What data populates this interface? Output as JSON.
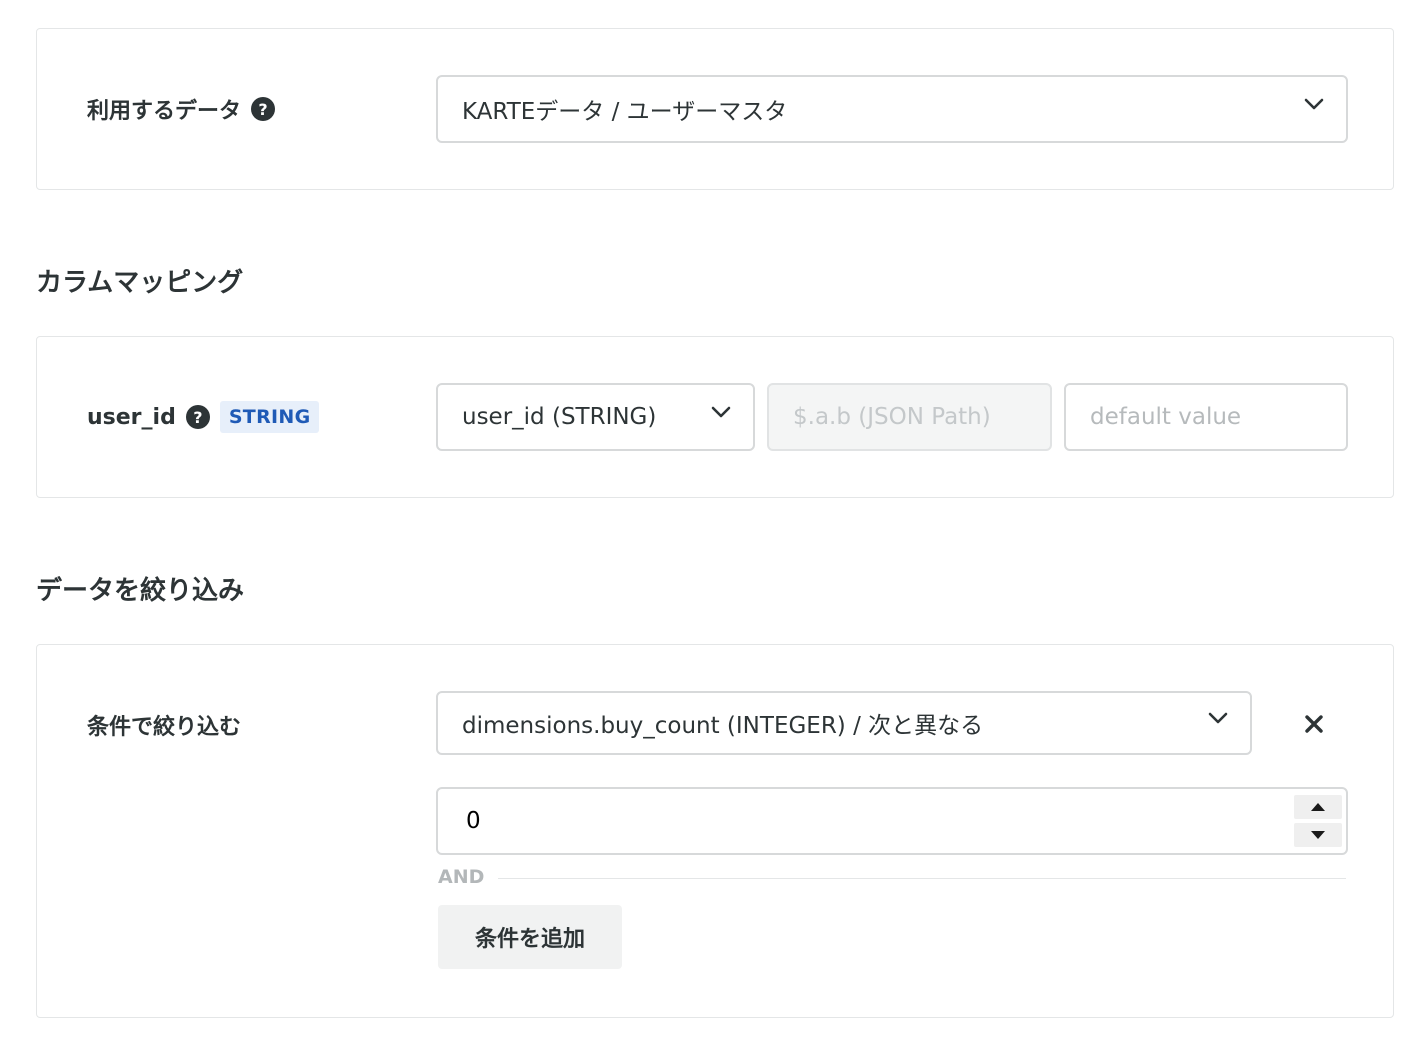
{
  "data_source": {
    "label": "利用するデータ",
    "help_icon": "?",
    "selected": "KARTEデータ / ユーザーマスタ"
  },
  "column_mapping": {
    "section_title": "カラムマッピング",
    "rows": [
      {
        "label": "user_id",
        "help_icon": "?",
        "type_badge": "STRING",
        "column_select": "user_id (STRING)",
        "json_path_placeholder": "$.a.b (JSON Path)",
        "default_value_placeholder": "default value"
      }
    ]
  },
  "filter": {
    "section_title": "データを絞り込み",
    "label": "条件で絞り込む",
    "condition_select": "dimensions.buy_count (INTEGER) / 次と異なる",
    "condition_value": "0",
    "and_label": "AND",
    "add_button": "条件を追加"
  },
  "colors": {
    "text": "#2d3436",
    "border": "#d7d9da",
    "badge_bg": "#e7effa",
    "badge_text": "#1f5ab6"
  },
  "icons": {
    "help": "question-circle-icon",
    "select": "chevron-down-icon",
    "remove": "close-icon",
    "increment": "caret-up-icon",
    "decrement": "caret-down-icon"
  }
}
